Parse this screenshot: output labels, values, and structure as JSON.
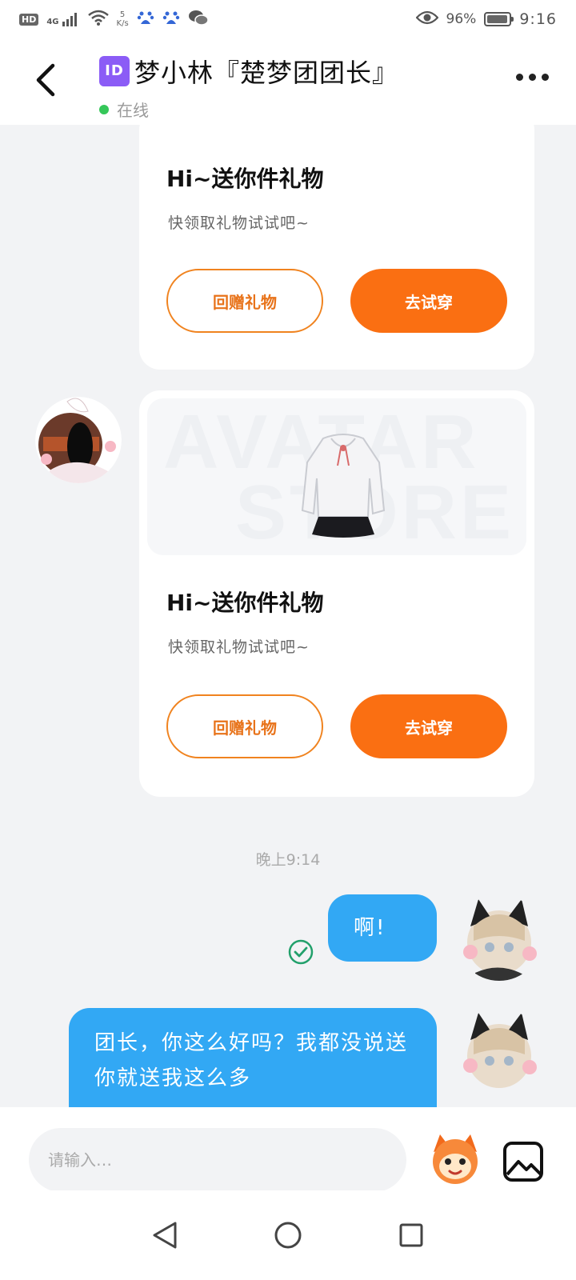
{
  "status_bar": {
    "network_badge": "HD",
    "signal": "4G",
    "net_speed_value": "5",
    "net_speed_unit": "K/s",
    "battery_percent": "96%",
    "battery_level": 0.96,
    "time": "9:16",
    "icons": [
      "hd-icon",
      "signal-icon",
      "wifi-icon",
      "baidu-icon",
      "baidu-icon",
      "wechat-icon",
      "eye-icon",
      "battery-icon"
    ]
  },
  "header": {
    "id_badge": "ID",
    "title": "梦小林『楚梦团团长』",
    "status": "在线",
    "back_icon": "chevron-left-icon",
    "more_icon": "more-dots-icon"
  },
  "messages": {
    "gift_card_1": {
      "title": "Hi~送你件礼物",
      "subtitle": "快领取礼物试试吧~",
      "return_gift_label": "回赠礼物",
      "try_on_label": "去试穿"
    },
    "gift_card_2": {
      "watermark_line1": "AVATAR",
      "watermark_line2": "STORE",
      "title": "Hi~送你件礼物",
      "subtitle": "快领取礼物试试吧~",
      "return_gift_label": "回赠礼物",
      "try_on_label": "去试穿"
    },
    "timestamp": "晚上9:14",
    "my_message_1": "啊!",
    "my_message_2": "团长，你这么好吗？我都没说送你就送我这么多"
  },
  "input": {
    "placeholder": "请输入…"
  },
  "colors": {
    "accent_orange": "#fa6f12",
    "bubble_blue": "#32a8f4",
    "online_green": "#35c759",
    "read_green": "#22a06b"
  }
}
